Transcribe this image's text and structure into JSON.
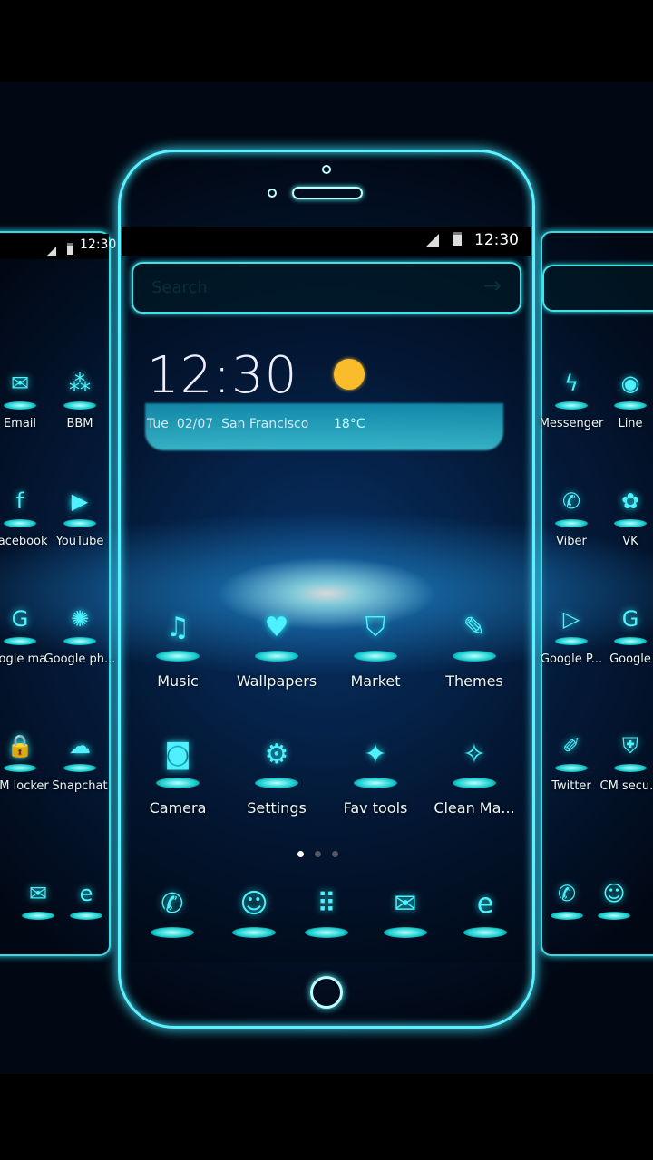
{
  "status_bar": {
    "time": "12:30"
  },
  "search": {
    "placeholder": "Search",
    "icon": "arrow-right-icon"
  },
  "weather_widget": {
    "time": "12:30",
    "day": "Tue",
    "date": "02/07",
    "city": "San Francisco",
    "temperature": "18°C",
    "icon": "sun-icon"
  },
  "apps": [
    {
      "label": "Music",
      "glyph": "♫"
    },
    {
      "label": "Wallpapers",
      "glyph": "♥"
    },
    {
      "label": "Market",
      "glyph": "⛉"
    },
    {
      "label": "Themes",
      "glyph": "✎"
    },
    {
      "label": "Camera",
      "glyph": "◙"
    },
    {
      "label": "Settings",
      "glyph": "⚙"
    },
    {
      "label": "Fav tools",
      "glyph": "✦"
    },
    {
      "label": "Clean Ma...",
      "glyph": "✧"
    }
  ],
  "page_indicator": {
    "pages": 3,
    "current": 1
  },
  "dock": [
    {
      "name": "phone",
      "glyph": "✆"
    },
    {
      "name": "contacts",
      "glyph": "☺"
    },
    {
      "name": "app-drawer",
      "glyph": "⠿"
    },
    {
      "name": "messages",
      "glyph": "✉"
    },
    {
      "name": "browser",
      "glyph": "e"
    }
  ],
  "left_preview": {
    "time": "12:30",
    "apps": [
      {
        "label": "Email",
        "glyph": "✉"
      },
      {
        "label": "BBM",
        "glyph": "⁂"
      },
      {
        "label": "Facebook",
        "glyph": "f"
      },
      {
        "label": "YouTube",
        "glyph": "▶"
      },
      {
        "label": "Google ma...",
        "glyph": "G"
      },
      {
        "label": "Google ph...",
        "glyph": "✺"
      },
      {
        "label": "CM locker",
        "glyph": "🔒"
      },
      {
        "label": "Snapchat",
        "glyph": "☁"
      }
    ],
    "dock": [
      {
        "glyph": "✉"
      },
      {
        "glyph": "e"
      }
    ]
  },
  "right_preview": {
    "apps": [
      {
        "label": "Messenger",
        "glyph": "ϟ"
      },
      {
        "label": "Line",
        "glyph": "◉"
      },
      {
        "label": "Viber",
        "glyph": "✆"
      },
      {
        "label": "VK",
        "glyph": "✿"
      },
      {
        "label": "Google P...",
        "glyph": "▷"
      },
      {
        "label": "Google",
        "glyph": "G"
      },
      {
        "label": "Twitter",
        "glyph": "✐"
      },
      {
        "label": "CM secu...",
        "glyph": "⛨"
      }
    ],
    "dock": [
      {
        "glyph": "✆"
      },
      {
        "glyph": "☺"
      }
    ]
  },
  "colors": {
    "accent": "#3fe3e8",
    "sun": "#fbbc2c",
    "background": "#041a3a"
  }
}
